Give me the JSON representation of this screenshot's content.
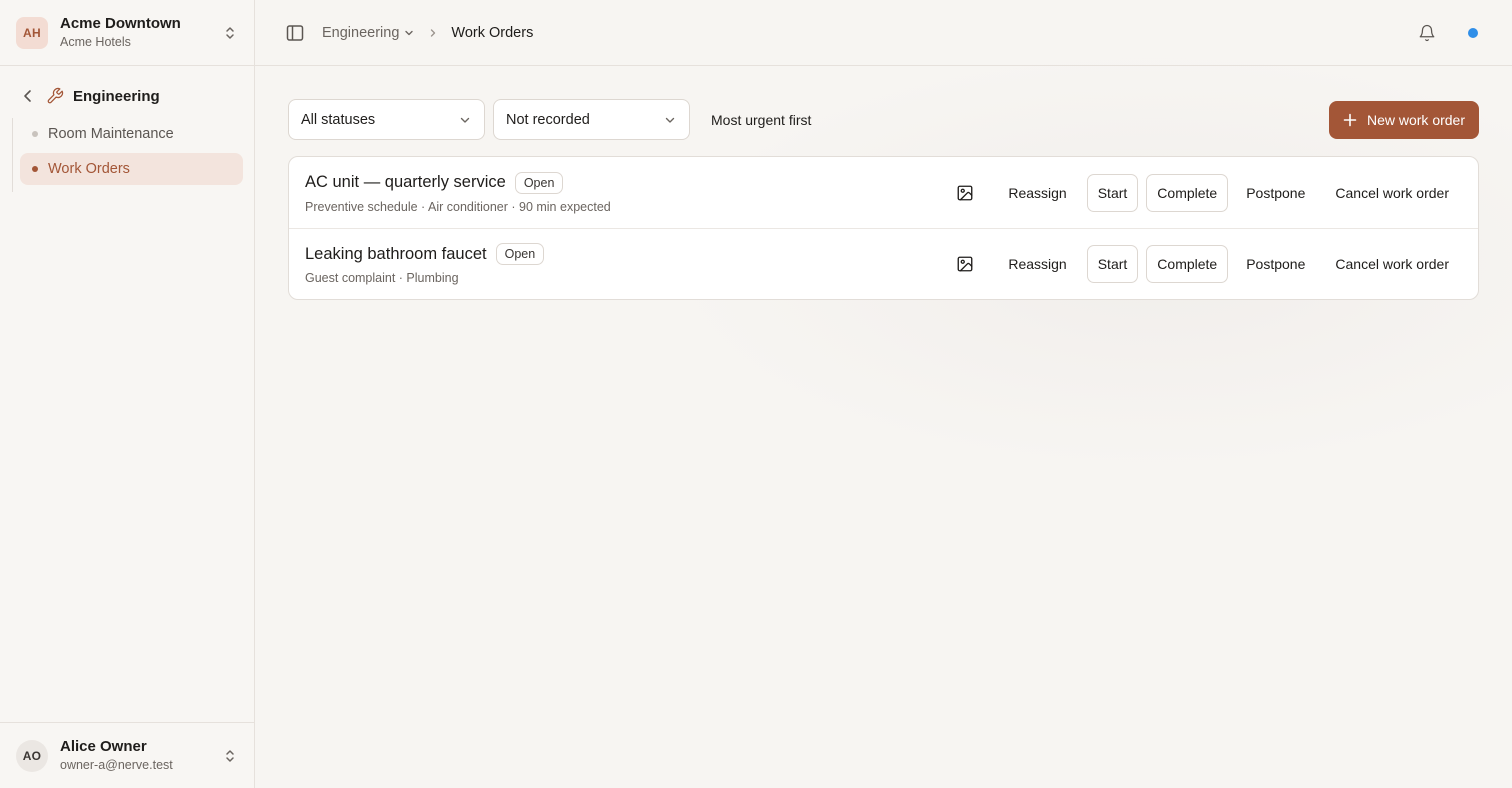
{
  "org": {
    "initials": "AH",
    "name": "Acme Downtown",
    "sub": "Acme Hotels"
  },
  "section": {
    "title": "Engineering"
  },
  "nav": [
    {
      "label": "Room Maintenance",
      "active": false
    },
    {
      "label": "Work Orders",
      "active": true
    }
  ],
  "user": {
    "initials": "AO",
    "name": "Alice Owner",
    "email": "owner-a@nerve.test"
  },
  "breadcrumb": {
    "parent": "Engineering",
    "current": "Work Orders"
  },
  "filters": {
    "status": "All statuses",
    "recorded": "Not recorded",
    "sort": "Most urgent first",
    "new_button": "New work order"
  },
  "work_orders": [
    {
      "title": "AC unit — quarterly service",
      "status": "Open",
      "meta": "Preventive schedule · Air conditioner · 90 min expected"
    },
    {
      "title": "Leaking bathroom faucet",
      "status": "Open",
      "meta": "Guest complaint · Plumbing"
    }
  ],
  "actions": {
    "reassign": "Reassign",
    "start": "Start",
    "complete": "Complete",
    "postpone": "Postpone",
    "cancel": "Cancel work order"
  },
  "colors": {
    "accent": "#a35637",
    "status_dot": "#2f8ee8"
  },
  "icons": [
    "chevrons-up-down-icon",
    "chevron-left-icon",
    "wrench-icon",
    "sidebar-toggle-icon",
    "bell-icon",
    "image-icon",
    "plus-icon"
  ]
}
